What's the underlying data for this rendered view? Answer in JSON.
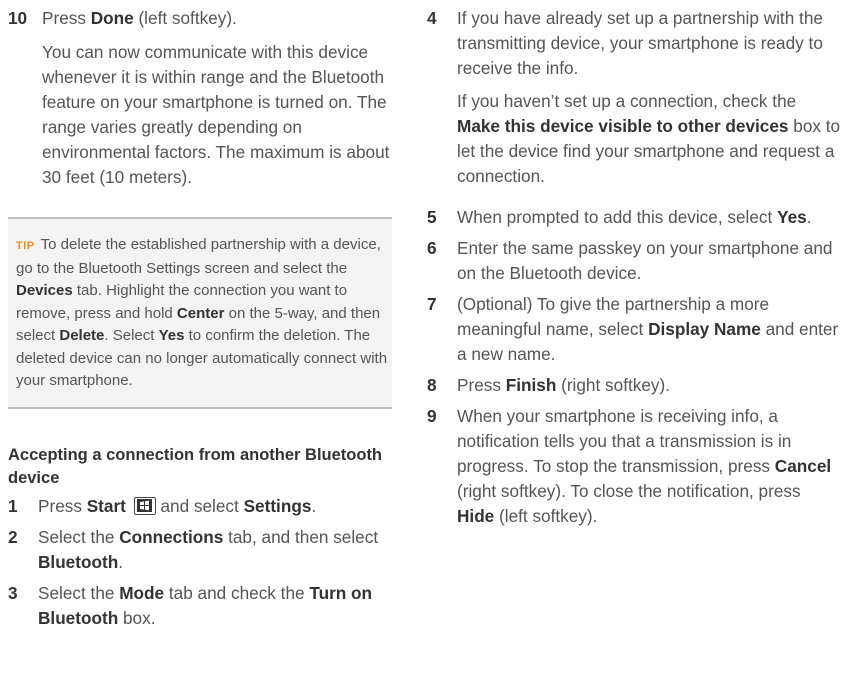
{
  "left": {
    "step10": {
      "num": "10",
      "a": "Press ",
      "b": "Done",
      "c": " (left softkey)."
    },
    "step10_para": "You can now communicate with this device whenever it is within range and the Bluetooth feature on your smartphone is turned on. The range varies greatly depending on environmental factors. The maximum is about 30 feet (10 meters).",
    "tip": {
      "label": "TIP",
      "t1": "To delete the established partnership with a device, go to the Bluetooth Settings screen and select the ",
      "b1": "Devices",
      "t2": " tab. Highlight the connection you want to remove, press and hold ",
      "b2": "Center",
      "t3": " on the 5-way, and then select ",
      "b3": "Delete",
      "t4": ". Select ",
      "b4": "Yes",
      "t5": " to confirm the deletion. The deleted device can no longer automatically connect with your smartphone."
    },
    "heading": "Accepting a connection from another Bluetooth device",
    "step1": {
      "num": "1",
      "a": "Press ",
      "b": "Start",
      "c": " and select ",
      "d": "Settings",
      "e": "."
    },
    "step2": {
      "num": "2",
      "a": "Select the ",
      "b": "Connections",
      "c": " tab, and then select ",
      "d": "Bluetooth",
      "e": "."
    },
    "step3": {
      "num": "3",
      "a": "Select the ",
      "b": "Mode",
      "c": " tab and check the ",
      "d": "Turn on Bluetooth",
      "e": " box."
    }
  },
  "right": {
    "step4": {
      "num": "4",
      "text": "If you have already set up a partnership with the transmitting device, your smartphone is ready to receive the info."
    },
    "step4_para": {
      "a": "If you haven’t set up a connection, check the ",
      "b": "Make this device visible to other devices",
      "c": " box to let the device find your smartphone and request a connection."
    },
    "step5": {
      "num": "5",
      "a": "When prompted to add this device, select ",
      "b": "Yes",
      "c": "."
    },
    "step6": {
      "num": "6",
      "text": "Enter the same passkey on your smartphone and on the Bluetooth device."
    },
    "step7": {
      "num": "7",
      "a": "(Optional) To give the partnership a more meaningful name, select ",
      "b": "Display Name",
      "c": " and enter a new name."
    },
    "step8": {
      "num": "8",
      "a": "Press ",
      "b": "Finish",
      "c": " (right softkey)."
    },
    "step9": {
      "num": "9",
      "a": "When your smartphone is receiving info, a notification tells you that a transmission is in progress. To stop the transmission, press ",
      "b": "Cancel",
      "c": " (right softkey). To close the notification, press ",
      "d": "Hide",
      "e": " (left softkey)."
    }
  }
}
